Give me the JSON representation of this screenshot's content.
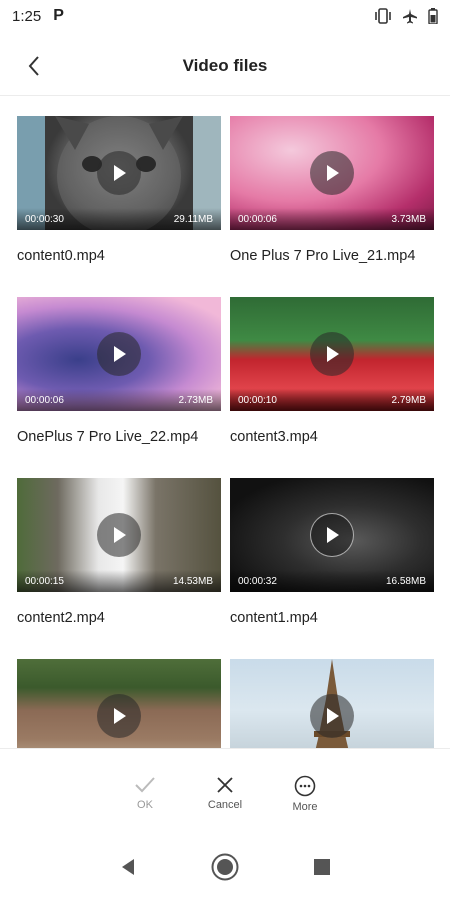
{
  "status": {
    "time": "1:25",
    "app_letter": "P"
  },
  "header": {
    "title": "Video files"
  },
  "videos": [
    {
      "name": "content0.mp4",
      "duration": "00:00:30",
      "size": "29.11MB"
    },
    {
      "name": "One Plus 7 Pro Live_21.mp4",
      "duration": "00:00:06",
      "size": "3.73MB"
    },
    {
      "name": "OnePlus 7 Pro Live_22.mp4",
      "duration": "00:00:06",
      "size": "2.73MB"
    },
    {
      "name": "content3.mp4",
      "duration": "00:00:10",
      "size": "2.79MB"
    },
    {
      "name": "content2.mp4",
      "duration": "00:00:15",
      "size": "14.53MB"
    },
    {
      "name": "content1.mp4",
      "duration": "00:00:32",
      "size": "16.58MB"
    },
    {
      "name": "",
      "duration": "",
      "size": ""
    },
    {
      "name": "",
      "duration": "",
      "size": ""
    }
  ],
  "actions": {
    "ok": "OK",
    "cancel": "Cancel",
    "more": "More"
  },
  "colors": {
    "accent": "#222222",
    "disabled": "#bbbbbb"
  }
}
